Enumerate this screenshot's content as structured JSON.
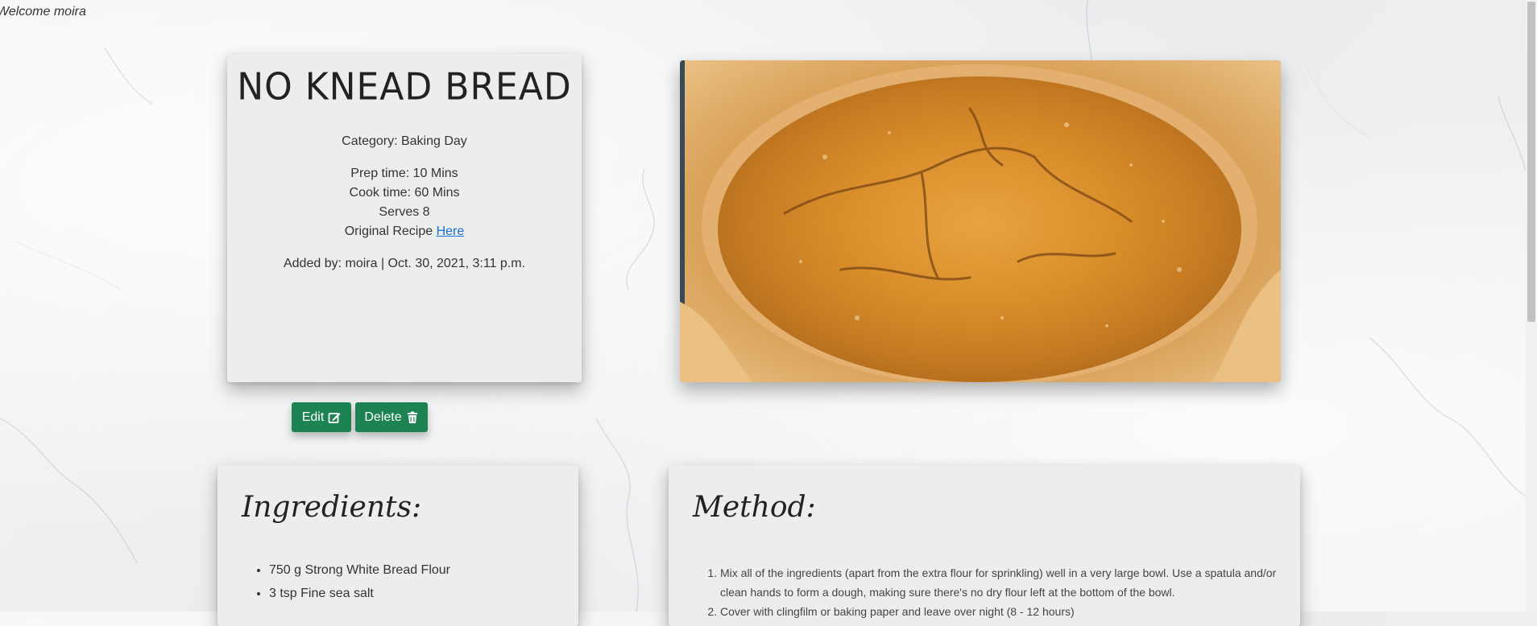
{
  "header": {
    "welcome": "Welcome moira"
  },
  "recipe": {
    "title": "NO KNEAD BREAD",
    "category": "Category: Baking Day",
    "prep_time": "Prep time: 10 Mins",
    "cook_time": "Cook time: 60 Mins",
    "serves": "Serves 8",
    "original_recipe_label": "Original Recipe",
    "original_recipe_link": "Here",
    "added_by": "Added by: moira | Oct. 30, 2021, 3:11 p.m."
  },
  "actions": {
    "edit_label": "Edit",
    "delete_label": "Delete"
  },
  "ingredients": {
    "title": "Ingredients:",
    "items": [
      "750 g Strong White Bread Flour",
      " 3 tsp Fine sea salt"
    ]
  },
  "method": {
    "title": "Method:",
    "steps": [
      "Mix all of the ingredients (apart from the extra flour for sprinkling) well in a very large bowl. Use a spatula and/or clean hands to form a dough, making sure there's no dry flour left at the bottom of the bowl.",
      "Cover with clingfilm or baking paper and leave over night (8 - 12 hours)"
    ]
  },
  "colors": {
    "button": "#1e8352",
    "card": "#eceeeb",
    "link": "#1a6fd1"
  },
  "icons": {
    "edit": "edit-icon",
    "delete": "trash-icon"
  }
}
